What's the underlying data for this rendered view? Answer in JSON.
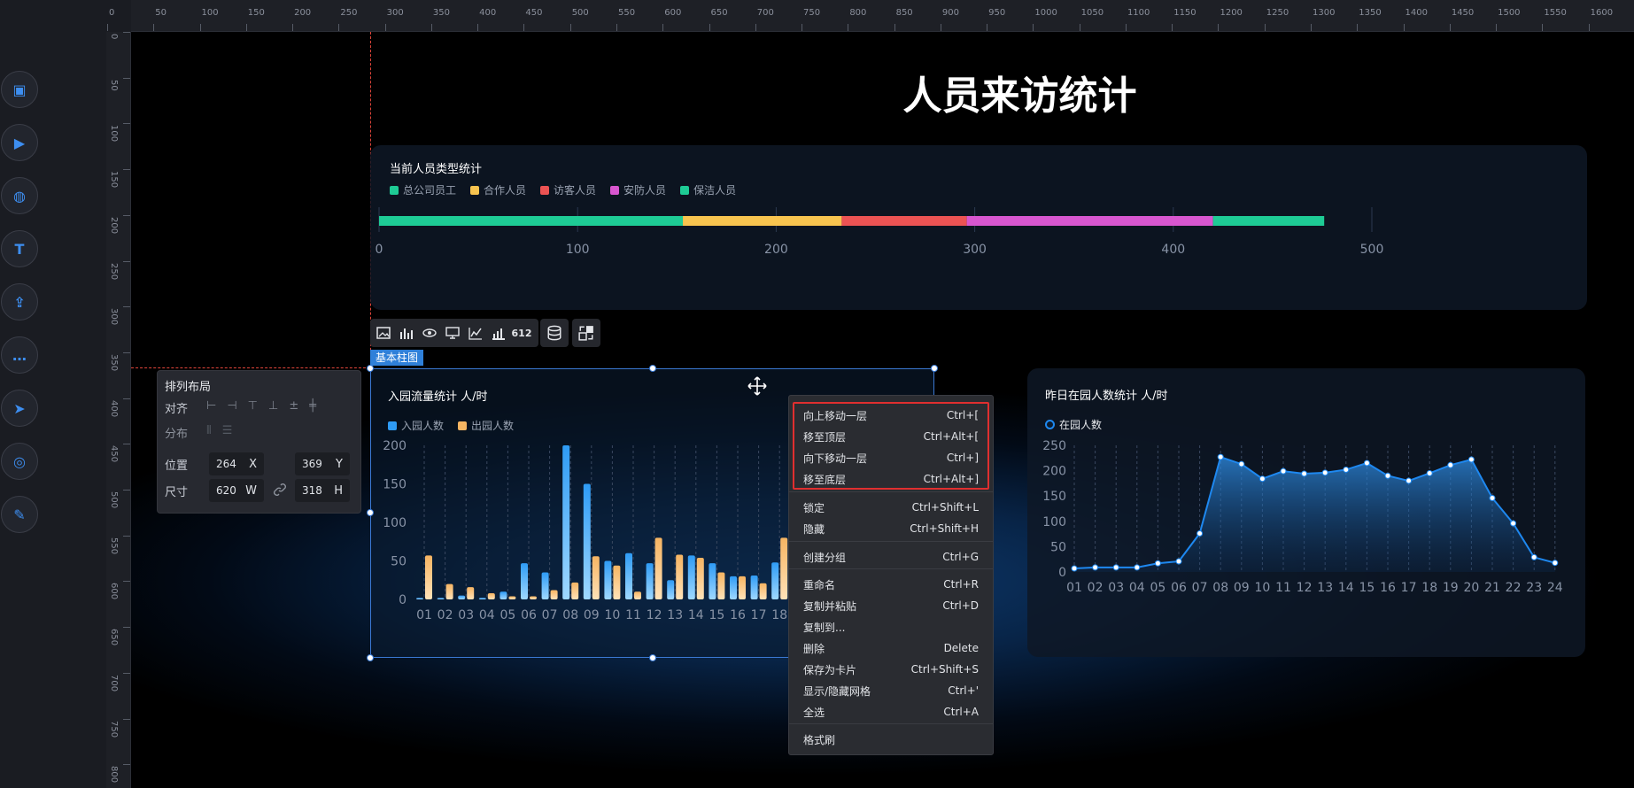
{
  "ruler": {
    "top_labels": [
      "0",
      "50",
      "100",
      "150",
      "200",
      "250",
      "300",
      "350",
      "400",
      "450",
      "500",
      "550",
      "600",
      "650",
      "700",
      "750",
      "800",
      "850",
      "900",
      "950",
      "1000",
      "1050",
      "1100",
      "1150",
      "1200",
      "1250",
      "1300",
      "1350",
      "1400",
      "1450",
      "1500",
      "1550",
      "1600"
    ],
    "left_labels": [
      "0",
      "50",
      "100",
      "150",
      "200",
      "250",
      "300",
      "350",
      "400",
      "450",
      "500",
      "550",
      "600",
      "650",
      "700",
      "750",
      "800"
    ]
  },
  "sidebar": {
    "icons": [
      "picture-icon",
      "media-icon",
      "globe-icon",
      "text-icon",
      "upload-icon",
      "chat-icon",
      "send-icon",
      "target-icon",
      "settings-icon"
    ]
  },
  "page": {
    "title": "人员来访统计"
  },
  "staff_chart": {
    "title": "当前人员类型统计",
    "chart_data": {
      "type": "bar",
      "orientation": "horizontal-stacked",
      "series": [
        {
          "name": "总公司员工",
          "value": 153,
          "color": "#1ecb95"
        },
        {
          "name": "合作人员",
          "value": 80,
          "color": "#f8c44f"
        },
        {
          "name": "访客人员",
          "value": 63,
          "color": "#ec5353"
        },
        {
          "name": "安防人员",
          "value": 124,
          "color": "#d856cf"
        },
        {
          "name": "保洁人员",
          "value": 56,
          "color": "#1ecb95"
        }
      ],
      "xlim": [
        0,
        500
      ],
      "ticks": [
        "0",
        "100",
        "200",
        "300",
        "400",
        "500"
      ]
    }
  },
  "toolbar": {
    "icons": [
      "image-icon",
      "bar-chart-icon",
      "eye-icon",
      "monitor-icon",
      "line-chart-icon",
      "column-chart-icon",
      "number-icon",
      "database-icon",
      "swap-icon"
    ],
    "number_label": "612"
  },
  "selected_tag": "基本柱图",
  "flow_chart": {
    "title": "入园流量统计 人/时",
    "chart_data": {
      "type": "bar",
      "categories": [
        "01",
        "02",
        "03",
        "04",
        "05",
        "06",
        "07",
        "08",
        "09",
        "10",
        "11",
        "12",
        "13",
        "14",
        "15",
        "16",
        "17",
        "18"
      ],
      "series": [
        {
          "name": "入园人数",
          "color": "#2e9bf5",
          "values": [
            2,
            2,
            5,
            2,
            10,
            47,
            35,
            200,
            150,
            50,
            60,
            47,
            25,
            57,
            47,
            30,
            31,
            48
          ]
        },
        {
          "name": "出园人数",
          "color": "#f6b462",
          "values": [
            57,
            20,
            16,
            8,
            4,
            4,
            12,
            22,
            56,
            44,
            10,
            80,
            58,
            54,
            35,
            30,
            21,
            80
          ]
        }
      ],
      "ylim": [
        0,
        200
      ],
      "yticks": [
        "0",
        "50",
        "100",
        "150",
        "200"
      ]
    }
  },
  "park_chart": {
    "title": "昨日在园人数统计 人/时",
    "chart_data": {
      "type": "area",
      "x": [
        "01",
        "02",
        "03",
        "04",
        "05",
        "06",
        "07",
        "08",
        "09",
        "10",
        "11",
        "12",
        "13",
        "14",
        "15",
        "16",
        "17",
        "18",
        "19",
        "20",
        "21",
        "22",
        "23",
        "24"
      ],
      "series": [
        {
          "name": "在园人数",
          "color": "#1e88f0",
          "values": [
            7,
            9,
            9,
            9,
            17,
            21,
            76,
            227,
            213,
            184,
            199,
            194,
            196,
            202,
            215,
            190,
            180,
            195,
            211,
            222,
            146,
            96,
            29,
            18
          ]
        }
      ],
      "ylim": [
        0,
        250
      ],
      "yticks": [
        "0",
        "50",
        "100",
        "150",
        "200",
        "250"
      ]
    }
  },
  "arrange": {
    "title": "排列布局",
    "align_label": "对齐",
    "distribute_label": "分布",
    "position_label": "位置",
    "size_label": "尺寸",
    "x_value": "264",
    "x_unit": "X",
    "y_value": "369",
    "y_unit": "Y",
    "w_value": "620",
    "w_unit": "W",
    "h_value": "318",
    "h_unit": "H"
  },
  "context_menu": {
    "items": [
      {
        "label": "向上移动一层",
        "shortcut": "Ctrl+["
      },
      {
        "label": "移至顶层",
        "shortcut": "Ctrl+Alt+["
      },
      {
        "label": "向下移动一层",
        "shortcut": "Ctrl+]"
      },
      {
        "label": "移至底层",
        "shortcut": "Ctrl+Alt+]"
      },
      {
        "label": "锁定",
        "shortcut": "Ctrl+Shift+L"
      },
      {
        "label": "隐藏",
        "shortcut": "Ctrl+Shift+H"
      },
      {
        "label": "创建分组",
        "shortcut": "Ctrl+G"
      },
      {
        "label": "重命名",
        "shortcut": "Ctrl+R"
      },
      {
        "label": "复制并粘贴",
        "shortcut": "Ctrl+D"
      },
      {
        "label": "复制到...",
        "shortcut": ""
      },
      {
        "label": "删除",
        "shortcut": "Delete"
      },
      {
        "label": "保存为卡片",
        "shortcut": "Ctrl+Shift+S"
      },
      {
        "label": "显示/隐藏网格",
        "shortcut": "Ctrl+'"
      },
      {
        "label": "全选",
        "shortcut": "Ctrl+A"
      },
      {
        "label": "格式刷",
        "shortcut": ""
      }
    ]
  }
}
